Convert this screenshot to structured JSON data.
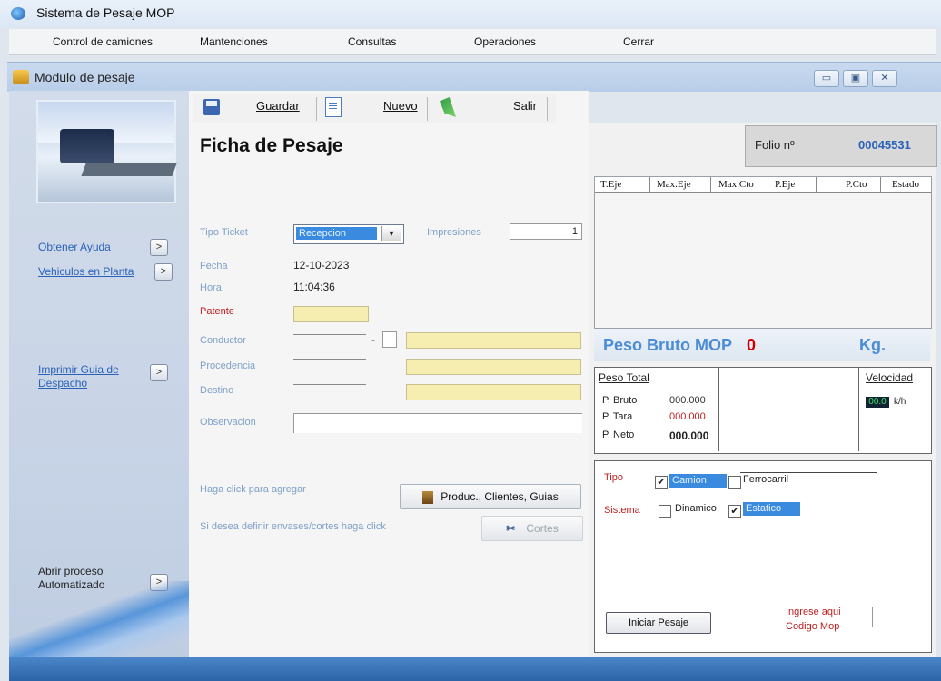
{
  "app": {
    "title": "Sistema de Pesaje MOP"
  },
  "menu": [
    {
      "label": "Control de camiones"
    },
    {
      "label": "Mantenciones"
    },
    {
      "label": "Consultas"
    },
    {
      "label": "Operaciones"
    },
    {
      "label": "Cerrar"
    }
  ],
  "child": {
    "title": "Modulo de pesaje"
  },
  "sidebar": {
    "ayuda": "Obtener Ayuda",
    "vehiculos": "Vehiculos en Planta",
    "imprimir": "Imprimir Guia de Despacho",
    "abrir": "Abrir proceso Automatizado",
    "arrow": ">"
  },
  "toolbar": {
    "guardar": "Guardar",
    "nuevo": "Nuevo",
    "salir": "Salir"
  },
  "form": {
    "heading": "Ficha de Pesaje",
    "tipo_ticket_label": "Tipo Ticket",
    "tipo_ticket_value": "Recepcion",
    "impresiones_label": "Impresiones",
    "impresiones_value": "1",
    "fecha_label": "Fecha",
    "fecha_value": "12-10-2023",
    "hora_label": "Hora",
    "hora_value": "11:04:36",
    "patente_label": "Patente",
    "conductor_label": "Conductor",
    "dash": "-",
    "procedencia_label": "Procedencia",
    "destino_label": "Destino",
    "observacion_label": "Observacion",
    "agregar_text": "Haga click para agregar",
    "produc_button": "Produc., Clientes, Guias",
    "envases_text": "Si desea definir envases/cortes haga click",
    "cortes_button": "Cortes"
  },
  "folio": {
    "label": "Folio nº",
    "value": "00045531"
  },
  "grid": {
    "columns": [
      "T.Eje",
      "Max.Eje",
      "Max.Cto",
      "P.Eje",
      "P.Cto",
      "Estado"
    ]
  },
  "peso_bruto": {
    "label": "Peso Bruto MOP",
    "value": "0",
    "unit": "Kg."
  },
  "peso_total": {
    "title": "Peso Total",
    "bruto_label": "P. Bruto",
    "bruto_value": "000.000",
    "tara_label": "P. Tara",
    "tara_value": "000.000",
    "neto_label": "P. Neto",
    "neto_value": "000.000",
    "velocidad_label": "Velocidad",
    "velocidad_value": "00.0",
    "velocidad_unit": "k/h"
  },
  "tipo": {
    "tipo_label": "Tipo",
    "camion": "Camion",
    "camion_checked": true,
    "ferrocarril": "Ferrocarril",
    "ferrocarril_checked": false,
    "sistema_label": "Sistema",
    "dinamico": "Dinamico",
    "dinamico_checked": false,
    "estatico": "Estatico",
    "estatico_checked": true,
    "iniciar_button": "Iniciar Pesaje",
    "codigo_label_1": "Ingrese aqui",
    "codigo_label_2": "Codigo Mop"
  },
  "colors": {
    "accent": "#2a62b8",
    "label_blue": "#7fa0c8",
    "red": "#c02020",
    "field_yellow": "#f6eeb0"
  }
}
